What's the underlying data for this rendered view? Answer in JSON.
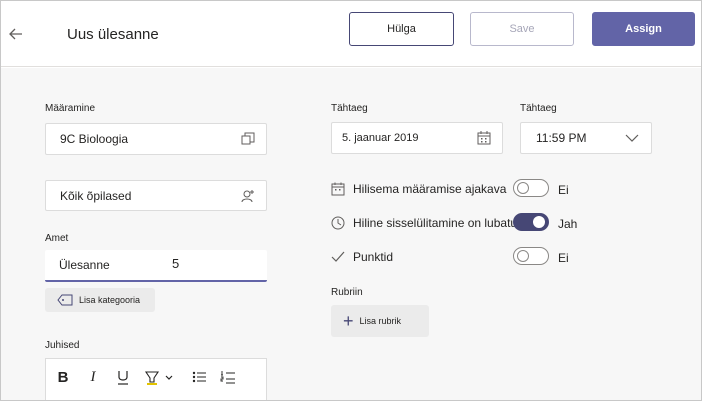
{
  "header": {
    "title": "Uus ülesanne",
    "discard_label": "Hülga",
    "save_label": "Save",
    "assign_label": "Assign"
  },
  "left": {
    "assign_label": "Määramine",
    "class_value": "9C Bioloogia",
    "students_value": "Kõik õpilased",
    "title_label": "Amet",
    "title_value": "Ülesanne",
    "title_cursor_text": "5",
    "category_button": "Lisa kategooria",
    "instructions_label": "Juhised"
  },
  "right": {
    "due_date_label": "Tähtaeg",
    "due_time_label": "Tähtaeg",
    "due_date_value": "5. jaanuar 2019",
    "due_time_value": "11:59 PM",
    "schedule_label": "Hilisema määramise ajakava",
    "schedule_state": "Ei",
    "late_label": "Hiline sisselülitamine on lubatud",
    "late_state": "Jah",
    "points_label": "Punktid",
    "points_state": "Ei",
    "rubric_label": "Rubriin",
    "rubric_button": "Lisa rubrik"
  },
  "colors": {
    "accent": "#6264a7",
    "accent_dark": "#464775"
  }
}
